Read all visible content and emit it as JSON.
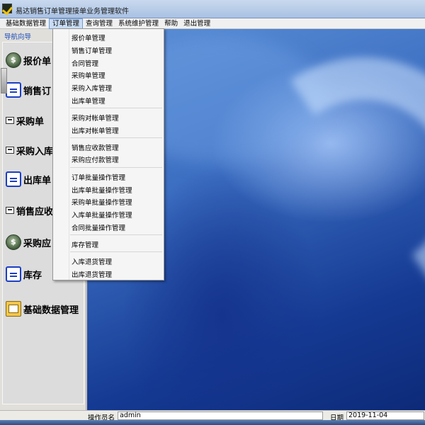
{
  "window": {
    "title": "易达销售订单管理接单业务管理软件"
  },
  "menubar": {
    "items": [
      "基础数据管理",
      "订单管理",
      "查询管理",
      "系统维护管理",
      "帮助",
      "退出管理"
    ],
    "active_index": 1
  },
  "nav": {
    "title": "导航向导",
    "buttons": [
      {
        "label": "报价单",
        "icon": "money-bag-icon"
      },
      {
        "label": "销售订",
        "icon": "document-icon"
      },
      {
        "label": "采购单",
        "icon": "card-icon"
      },
      {
        "label": "采购入库",
        "icon": "card-icon"
      },
      {
        "label": "出库单",
        "icon": "document-icon"
      },
      {
        "label": "销售应收",
        "icon": "card-icon"
      },
      {
        "label": "采购应",
        "icon": "money-bag-icon"
      },
      {
        "label": "库存",
        "icon": "document-icon"
      },
      {
        "label": "基础数据管理",
        "icon": "folder-icon"
      }
    ]
  },
  "dropdown": {
    "groups": [
      [
        "报价单管理",
        "销售订单管理",
        "合同管理",
        "采购单管理",
        "采购入库管理",
        "出库单管理"
      ],
      [
        "采购对帐单管理",
        "出库对帐单管理"
      ],
      [
        "销售应收款管理",
        "采购应付款管理"
      ],
      [
        "订单批量操作管理",
        "出库单批量操作管理",
        "采购单批量操作管理",
        "入库单批量操作管理",
        "合同批量操作管理"
      ],
      [
        "库存管理"
      ],
      [
        "入库退货管理",
        "出库退货管理"
      ]
    ]
  },
  "statusbar": {
    "operator_label": "操作员名",
    "operator_value": "admin",
    "date_label": "日期",
    "date_value": "2019-11-04"
  }
}
